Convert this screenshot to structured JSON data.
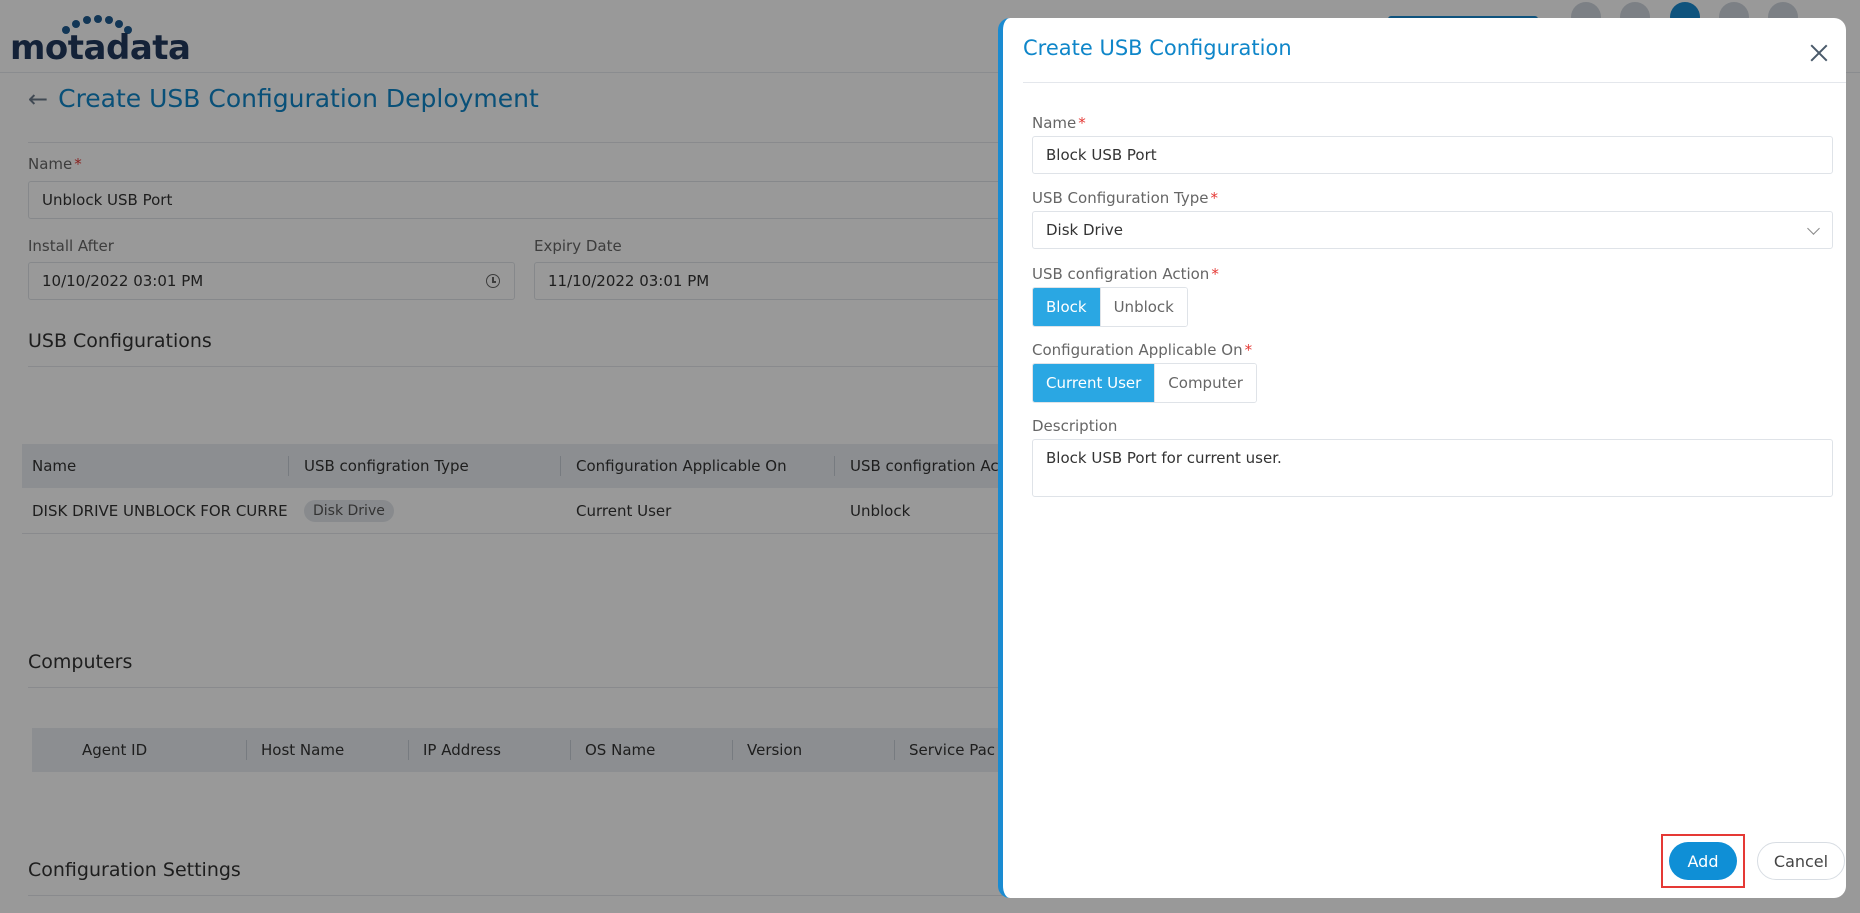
{
  "brand": {
    "logo_text": "motadata"
  },
  "page": {
    "title": "Create USB Configuration Deployment",
    "name_label": "Name",
    "name_value": "Unblock USB Port",
    "install_after_label": "Install After",
    "install_after_value": "10/10/2022 03:01 PM",
    "expiry_date_label": "Expiry Date",
    "expiry_date_value": "11/10/2022 03:01 PM"
  },
  "usb_section": {
    "title": "USB Configurations",
    "columns": [
      "Name",
      "USB configration Type",
      "Configuration Applicable On",
      "USB configration Ac"
    ],
    "rows": [
      {
        "name": "DISK DRIVE UNBLOCK FOR CURRE...",
        "type": "Disk Drive",
        "applicable_on": "Current User",
        "action": "Unblock"
      }
    ]
  },
  "computers_section": {
    "title": "Computers",
    "columns": [
      "Agent ID",
      "Host Name",
      "IP Address",
      "OS Name",
      "Version",
      "Service Pac"
    ]
  },
  "settings_section": {
    "title": "Configuration Settings"
  },
  "drawer": {
    "title": "Create USB Configuration",
    "name_label": "Name",
    "name_value": "Block USB Port",
    "type_label": "USB Configuration Type",
    "type_value": "Disk Drive",
    "action_label": "USB configration Action",
    "action_options": [
      "Block",
      "Unblock"
    ],
    "action_selected": "Block",
    "applicable_label": "Configuration Applicable On",
    "applicable_options": [
      "Current User",
      "Computer"
    ],
    "applicable_selected": "Current User",
    "description_label": "Description",
    "description_value": "Block USB Port for current user.",
    "add_label": "Add",
    "cancel_label": "Cancel"
  },
  "colors": {
    "accent": "#0f86c9",
    "active_segment": "#2aa7e3",
    "highlight": "#e53935"
  }
}
